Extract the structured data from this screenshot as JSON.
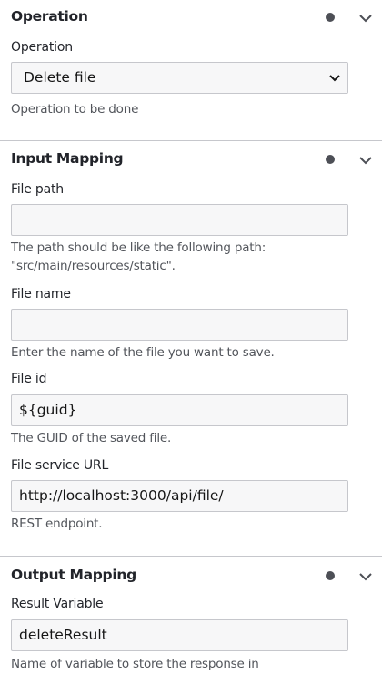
{
  "sections": [
    {
      "title": "Operation",
      "fields": [
        {
          "label": "Operation",
          "value": "Delete file",
          "help": "Operation to be done",
          "type": "select"
        }
      ]
    },
    {
      "title": "Input Mapping",
      "fields": [
        {
          "label": "File path",
          "value": "",
          "help": "The path should be like the following path: \"src/main/resources/static\"."
        },
        {
          "label": "File name",
          "value": "",
          "help": "Enter the name of the file you want to save."
        },
        {
          "label": "File id",
          "value": "${guid}",
          "help": "The GUID of the saved file."
        },
        {
          "label": "File service URL",
          "value": "http://localhost:3000/api/file/",
          "help": "REST endpoint."
        }
      ]
    },
    {
      "title": "Output Mapping",
      "fields": [
        {
          "label": "Result Variable",
          "value": "deleteResult",
          "help": "Name of variable to store the response in"
        }
      ]
    }
  ]
}
